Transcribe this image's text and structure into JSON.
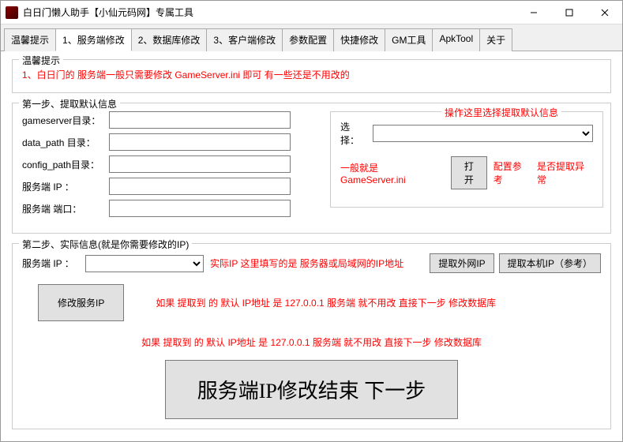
{
  "window": {
    "title": "白日门懒人助手【小仙元码网】专属工具"
  },
  "tabs": [
    "温馨提示",
    "1、服务端修改",
    "2、数据库修改",
    "3、客户端修改",
    "参数配置",
    "快捷修改",
    "GM工具",
    "ApkTool",
    "关于"
  ],
  "active_tab": 1,
  "hint": {
    "legend": "温馨提示",
    "text": "1、白日门的 服务端一般只需要修改 GameServer.ini 即可 有一些还是不用改的"
  },
  "step1": {
    "legend": "第一步、提取默认信息",
    "fields": {
      "gameserver": {
        "label": "gameserver目录：",
        "value": ""
      },
      "data_path": {
        "label": "data_path 目录：",
        "value": ""
      },
      "config_path": {
        "label": "config_path目录：",
        "value": ""
      },
      "server_ip": {
        "label": "服务端 IP ：",
        "value": ""
      },
      "server_port": {
        "label": "服务端 端口：",
        "value": ""
      }
    },
    "right": {
      "legend": "操作这里选择提取默认信息",
      "select_label": "选择：",
      "line_prefix": "一般就是 GameServer.ini",
      "open_btn": "打开",
      "line_mid": "配置参考",
      "line_suffix": "是否提取异常"
    }
  },
  "step2": {
    "legend": "第二步、实际信息(就是你需要修改的IP)",
    "server_ip_label": "服务端 IP ：",
    "server_ip_value": "",
    "real_ip_note": "实际IP 这里填写的是 服务器或局域网的IP地址",
    "btn_get_wan": "提取外网IP",
    "btn_get_local": "提取本机IP（参考）",
    "btn_modify": "修改服务IP",
    "note1": "如果 提取到 的 默认 IP地址 是 127.0.0.1 服务端 就不用改 直接下一步 修改数据库",
    "note2": "如果 提取到 的 默认 IP地址 是 127.0.0.1 服务端 就不用改 直接下一步 修改数据库",
    "big_button": "服务端IP修改结束 下一步"
  }
}
